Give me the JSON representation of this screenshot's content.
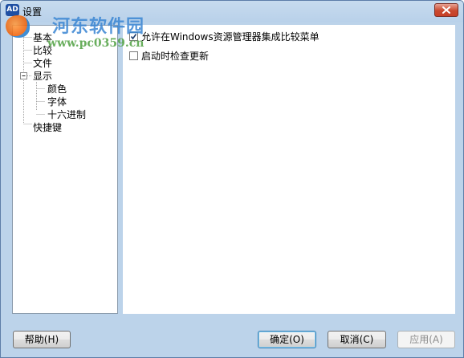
{
  "window": {
    "title": "设置",
    "app_icon": "AD"
  },
  "watermark": {
    "brand": "河东软件园",
    "url": "www.pc0359.cn"
  },
  "tree": {
    "items": [
      {
        "label": "基本"
      },
      {
        "label": "比较"
      },
      {
        "label": "文件"
      },
      {
        "label": "显示",
        "expanded": true
      },
      {
        "label": "颜色"
      },
      {
        "label": "字体"
      },
      {
        "label": "十六进制"
      },
      {
        "label": "快捷键"
      }
    ]
  },
  "options": [
    {
      "label": "允许在Windows资源管理器集成比较菜单",
      "checked": true
    },
    {
      "label": "启动时检查更新",
      "checked": false
    }
  ],
  "buttons": {
    "help": "帮助(H)",
    "ok": "确定(O)",
    "cancel": "取消(C)",
    "apply": "应用(A)"
  }
}
